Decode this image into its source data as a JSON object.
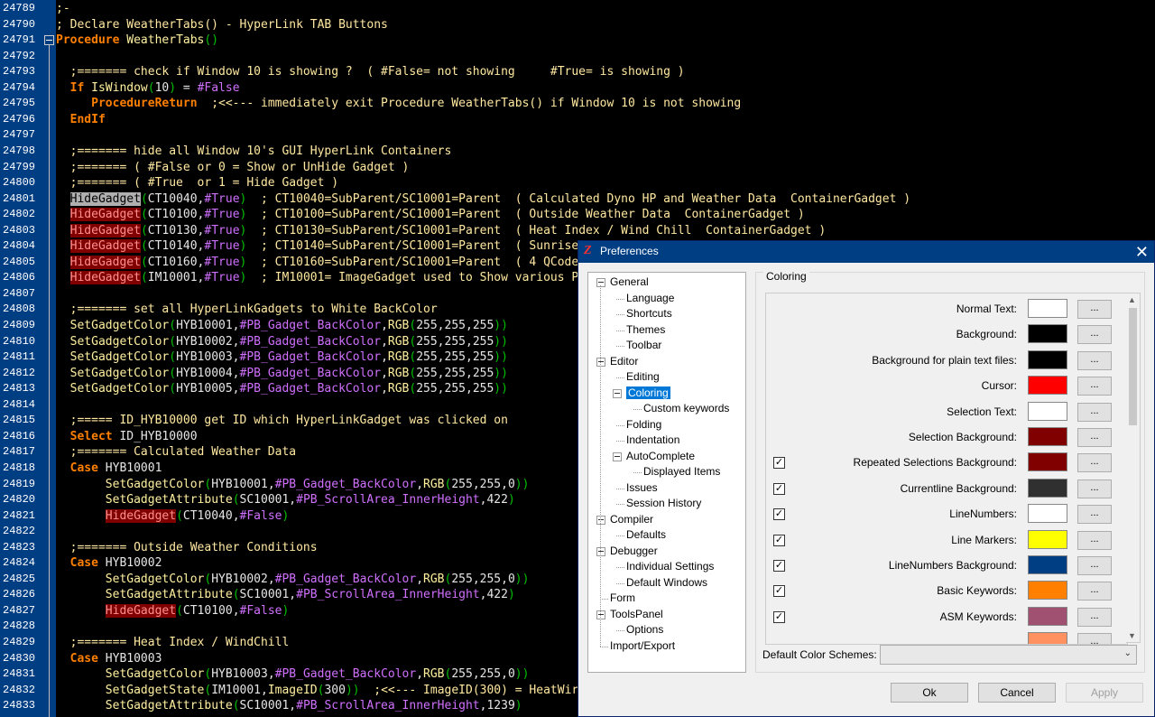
{
  "editor": {
    "lines": [
      {
        "n": "24789",
        "t": ";-"
      },
      {
        "n": "24790",
        "t": "; Declare WeatherTabs() - HyperLink TAB Buttons"
      },
      {
        "n": "24791",
        "t": "Procedure WeatherTabs()"
      },
      {
        "n": "24792",
        "t": ""
      },
      {
        "n": "24793",
        "t": "  ;======= check if Window 10 is showing ?  ( #False= not showing     #True= is showing )"
      },
      {
        "n": "24794",
        "t": "  If IsWindow(10) = #False"
      },
      {
        "n": "24795",
        "t": "     ProcedureReturn  ;<<--- immediately exit Procedure WeatherTabs() if Window 10 is not showing"
      },
      {
        "n": "24796",
        "t": "  EndIf"
      },
      {
        "n": "24797",
        "t": ""
      },
      {
        "n": "24798",
        "t": "  ;======= hide all Window 10's GUI HyperLink Containers"
      },
      {
        "n": "24799",
        "t": "  ;======= ( #False or 0 = Show or UnHide Gadget )"
      },
      {
        "n": "24800",
        "t": "  ;======= ( #True  or 1 = Hide Gadget )"
      },
      {
        "n": "24801",
        "t": "  HideGadget(CT10040,#True)  ; CT10040=SubParent/SC10001=Parent  ( Calculated Dyno HP and Weather Data  ContainerGadget )"
      },
      {
        "n": "24802",
        "t": "  HideGadget(CT10100,#True)  ; CT10100=SubParent/SC10001=Parent  ( Outside Weather Data  ContainerGadget )"
      },
      {
        "n": "24803",
        "t": "  HideGadget(CT10130,#True)  ; CT10130=SubParent/SC10001=Parent  ( Heat Index / Wind Chill  ContainerGadget )"
      },
      {
        "n": "24804",
        "t": "  HideGadget(CT10140,#True)  ; CT10140=SubParent/SC10001=Parent  ( Sunrise"
      },
      {
        "n": "24805",
        "t": "  HideGadget(CT10160,#True)  ; CT10160=SubParent/SC10001=Parent  ( 4 QCode"
      },
      {
        "n": "24806",
        "t": "  HideGadget(IM10001,#True)  ; IM10001= ImageGadget used to Show various P"
      },
      {
        "n": "24807",
        "t": ""
      },
      {
        "n": "24808",
        "t": "  ;======= set all HyperLinkGadgets to White BackColor"
      },
      {
        "n": "24809",
        "t": "  SetGadgetColor(HYB10001,#PB_Gadget_BackColor,RGB(255,255,255))"
      },
      {
        "n": "24810",
        "t": "  SetGadgetColor(HYB10002,#PB_Gadget_BackColor,RGB(255,255,255))"
      },
      {
        "n": "24811",
        "t": "  SetGadgetColor(HYB10003,#PB_Gadget_BackColor,RGB(255,255,255))"
      },
      {
        "n": "24812",
        "t": "  SetGadgetColor(HYB10004,#PB_Gadget_BackColor,RGB(255,255,255))"
      },
      {
        "n": "24813",
        "t": "  SetGadgetColor(HYB10005,#PB_Gadget_BackColor,RGB(255,255,255))"
      },
      {
        "n": "24814",
        "t": ""
      },
      {
        "n": "24815",
        "t": "  ;===== ID_HYB10000 get ID which HyperLinkGadget was clicked on"
      },
      {
        "n": "24816",
        "t": "  Select ID_HYB10000"
      },
      {
        "n": "24817",
        "t": "  ;======= Calculated Weather Data"
      },
      {
        "n": "24818",
        "t": "  Case HYB10001"
      },
      {
        "n": "24819",
        "t": "       SetGadgetColor(HYB10001,#PB_Gadget_BackColor,RGB(255,255,0))"
      },
      {
        "n": "24820",
        "t": "       SetGadgetAttribute(SC10001,#PB_ScrollArea_InnerHeight,422)"
      },
      {
        "n": "24821",
        "t": "       HideGadget(CT10040,#False)"
      },
      {
        "n": "24822",
        "t": ""
      },
      {
        "n": "24823",
        "t": "  ;======= Outside Weather Conditions"
      },
      {
        "n": "24824",
        "t": "  Case HYB10002"
      },
      {
        "n": "24825",
        "t": "       SetGadgetColor(HYB10002,#PB_Gadget_BackColor,RGB(255,255,0))"
      },
      {
        "n": "24826",
        "t": "       SetGadgetAttribute(SC10001,#PB_ScrollArea_InnerHeight,422)"
      },
      {
        "n": "24827",
        "t": "       HideGadget(CT10100,#False)"
      },
      {
        "n": "24828",
        "t": ""
      },
      {
        "n": "24829",
        "t": "  ;======= Heat Index / WindChill"
      },
      {
        "n": "24830",
        "t": "  Case HYB10003"
      },
      {
        "n": "24831",
        "t": "       SetGadgetColor(HYB10003,#PB_Gadget_BackColor,RGB(255,255,0))"
      },
      {
        "n": "24832",
        "t": "       SetGadgetState(IM10001,ImageID(300))  ;<<--- ImageID(300) = HeatWir"
      },
      {
        "n": "24833",
        "t": "       SetGadgetAttribute(SC10001,#PB_ScrollArea_InnerHeight,1239)"
      }
    ]
  },
  "dialog": {
    "title": "Preferences",
    "close_glyph": "✕",
    "app_icon_glyph": "Z",
    "tree": [
      {
        "label": "General",
        "level": 0,
        "expander": true
      },
      {
        "label": "Language",
        "level": 1
      },
      {
        "label": "Shortcuts",
        "level": 1
      },
      {
        "label": "Themes",
        "level": 1
      },
      {
        "label": "Toolbar",
        "level": 1
      },
      {
        "label": "Editor",
        "level": 0,
        "expander": true
      },
      {
        "label": "Editing",
        "level": 1
      },
      {
        "label": "Coloring",
        "level": 1,
        "expander": true,
        "selected": true
      },
      {
        "label": "Custom keywords",
        "level": 2
      },
      {
        "label": "Folding",
        "level": 1
      },
      {
        "label": "Indentation",
        "level": 1
      },
      {
        "label": "AutoComplete",
        "level": 1,
        "expander": true
      },
      {
        "label": "Displayed Items",
        "level": 2
      },
      {
        "label": "Issues",
        "level": 1
      },
      {
        "label": "Session History",
        "level": 1
      },
      {
        "label": "Compiler",
        "level": 0,
        "expander": true
      },
      {
        "label": "Defaults",
        "level": 1
      },
      {
        "label": "Debugger",
        "level": 0,
        "expander": true
      },
      {
        "label": "Individual Settings",
        "level": 1
      },
      {
        "label": "Default Windows",
        "level": 1
      },
      {
        "label": "Form",
        "level": 0
      },
      {
        "label": "ToolsPanel",
        "level": 0,
        "expander": true
      },
      {
        "label": "Options",
        "level": 1
      },
      {
        "label": "Import/Export",
        "level": 0
      }
    ],
    "coloring": {
      "title": "Coloring",
      "dots_label": "...",
      "check_glyph": "✓",
      "items": [
        {
          "label": "Normal Text:",
          "color": "#ffffff",
          "checkbox": false
        },
        {
          "label": "Background:",
          "color": "#000000",
          "checkbox": false
        },
        {
          "label": "Background for plain text files:",
          "color": "#000000",
          "checkbox": false
        },
        {
          "label": "Cursor:",
          "color": "#ff0000",
          "checkbox": false
        },
        {
          "label": "Selection Text:",
          "color": "#ffffff",
          "checkbox": false
        },
        {
          "label": "Selection Background:",
          "color": "#800000",
          "checkbox": false
        },
        {
          "label": "Repeated Selections Background:",
          "color": "#800000",
          "checkbox": true,
          "checked": true
        },
        {
          "label": "Currentline Background:",
          "color": "#303030",
          "checkbox": true,
          "checked": true
        },
        {
          "label": "LineNumbers:",
          "color": "#ffffff",
          "checkbox": true,
          "checked": true
        },
        {
          "label": "Line Markers:",
          "color": "#ffff00",
          "checkbox": true,
          "checked": true
        },
        {
          "label": "LineNumbers Background:",
          "color": "#003e84",
          "checkbox": true,
          "checked": true
        },
        {
          "label": "Basic Keywords:",
          "color": "#ff8000",
          "checkbox": true,
          "checked": true
        },
        {
          "label": "ASM Keywords:",
          "color": "#a05070",
          "checkbox": true,
          "checked": true
        },
        {
          "label": "",
          "color": "#ff9060",
          "checkbox": false
        }
      ]
    },
    "scheme_label": "Default Color Schemes:",
    "scheme_value": "",
    "buttons": {
      "ok": "Ok",
      "cancel": "Cancel",
      "apply": "Apply"
    }
  }
}
